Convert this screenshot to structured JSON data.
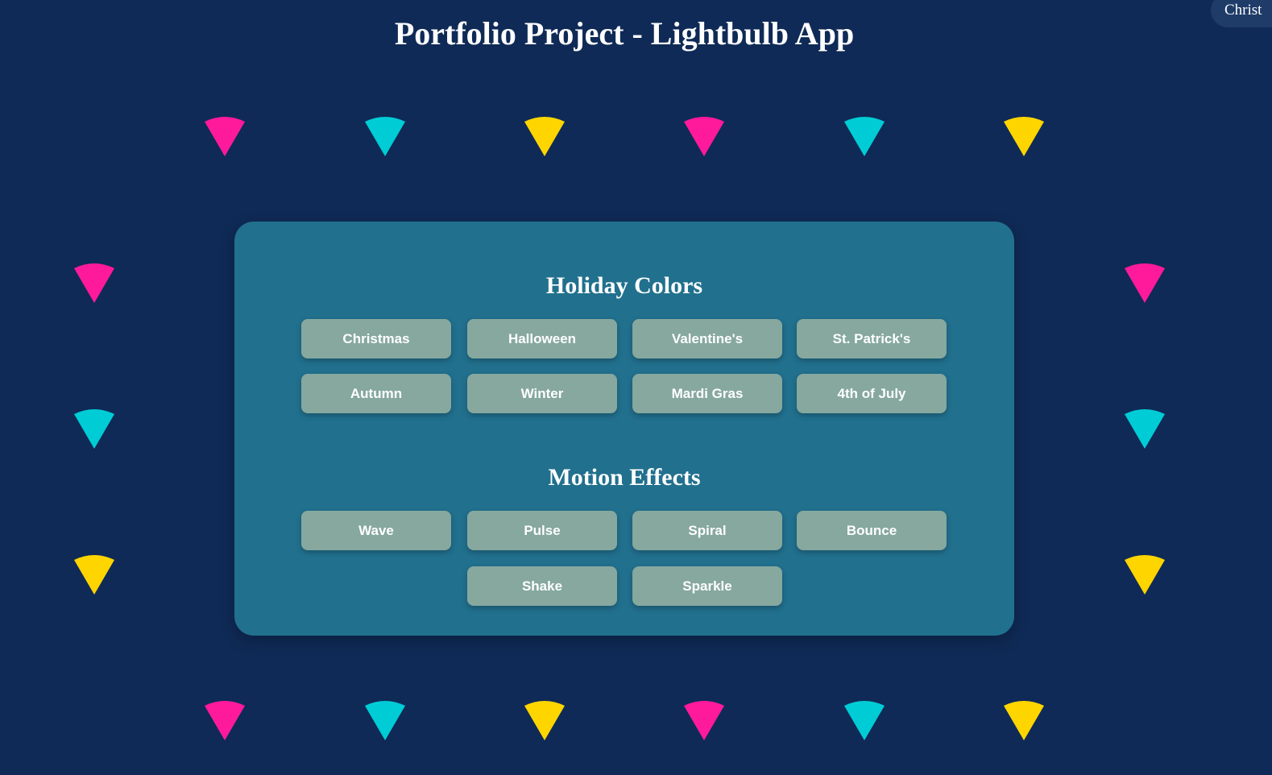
{
  "page": {
    "title": "Portfolio Project - Lightbulb App",
    "corner_chip": "Christ"
  },
  "colors": {
    "background": "#0f2a56",
    "panel": "#21708e",
    "button": "#86a89f",
    "bulb_pink": "#ff1a9c",
    "bulb_cyan": "#00ccd6",
    "bulb_yellow": "#ffd500"
  },
  "bulbs": {
    "top_row": [
      "pink",
      "cyan",
      "yellow",
      "pink",
      "cyan",
      "yellow"
    ],
    "left_column": [
      "pink",
      "cyan",
      "yellow"
    ],
    "right_column": [
      "pink",
      "cyan",
      "yellow"
    ],
    "bottom_row": [
      "pink",
      "cyan",
      "yellow",
      "pink",
      "cyan",
      "yellow"
    ]
  },
  "holiday": {
    "title": "Holiday Colors",
    "buttons": [
      "Christmas",
      "Halloween",
      "Valentine's",
      "St. Patrick's",
      "Autumn",
      "Winter",
      "Mardi Gras",
      "4th of July"
    ]
  },
  "motion": {
    "title": "Motion Effects",
    "buttons": [
      "Wave",
      "Pulse",
      "Spiral",
      "Bounce",
      "Shake",
      "Sparkle"
    ]
  }
}
